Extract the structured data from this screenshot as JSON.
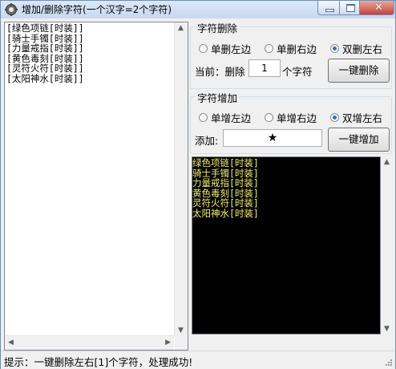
{
  "window": {
    "title": "增加/删除字符(一个汉字=2个字符)",
    "close_label": "✕"
  },
  "left_list": {
    "text": "[绿色项链[时装]]\n[骑士手镯[时装]]\n[力量戒指[时装]]\n[黄色毒刻[时装]]\n[灵符火符[时装]]\n[太阳神水[时装]]"
  },
  "delete_group": {
    "title": "字符删除",
    "options": [
      "单删左边",
      "单删右边",
      "双删左右"
    ],
    "selected": 2,
    "current_label": "当前：删除",
    "count": "1",
    "unit_label": "个字符",
    "button_label": "一键删除"
  },
  "add_group": {
    "title": "字符增加",
    "options": [
      "单增左边",
      "单增右边",
      "双增左右"
    ],
    "selected": 2,
    "add_label": "添加:",
    "add_value": "★",
    "button_label": "一键增加"
  },
  "output": {
    "text": "绿色项链[时装]\n骑士手镯[时装]\n力量戒指[时装]\n黄色毒刻[时装]\n灵符火符[时装]\n太阳神水[时装]"
  },
  "status": {
    "text": "提示：一键删除左右[1]个字符，处理成功!"
  }
}
